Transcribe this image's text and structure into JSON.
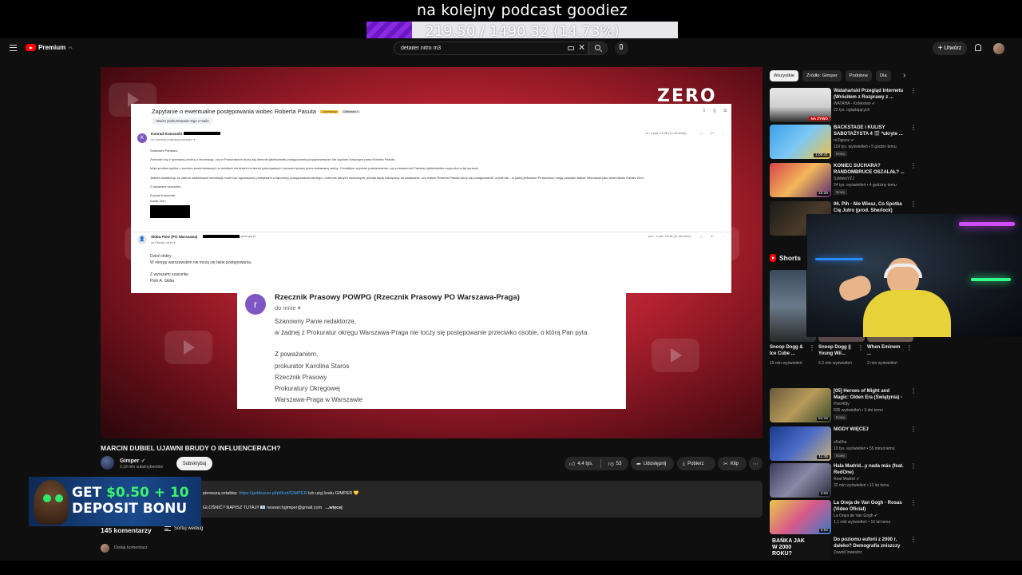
{
  "overlay": {
    "title": "na kolejny podcast goodiez",
    "goal_text": "219.50 / 1490.32 (14.73%)",
    "goal_progress": 0.1473,
    "goal_color": "#8a2be2"
  },
  "topbar": {
    "logo_text": "Premium",
    "logo_suffix": "PL",
    "search_value": "detailer nitro m3",
    "create_label": "Utwórz"
  },
  "player": {
    "zero_logo": "ZERO",
    "email1": {
      "subject": "Zapytanie o ewentualne postępowania wobec Roberta Pasuta",
      "tag1": "Z pomiędzy",
      "tag2": "Odebrane ×",
      "summary_label": "Utwórz podsumowanie tego e-maila",
      "msg1": {
        "initial": "K",
        "sender": "Konrad Kraszuski",
        "to": "do rzecznik.prasowy.prokuratur ▾",
        "date": "śr., 4 paź, 16:38 (12 dni temu)",
        "lines": [
          "Szanowni Państwo,",
          "Zwracam się z uprzejmą prośbą o informację, czy w Prokuraturze toczą się obecnie jakiekolwiek postępowania przygotowawcze lub sądowe dotyczące pana Roberta Pasuta.",
          "Moja prośba wynika z szeroko komentowanych w mediach doniesień na temat potencjalnych naruszeń prawa przez wskazaną osobę. Chciałbym uzyskać potwierdzenie, czy prowadzone Państwo jakiekolwiek czynności w tej sprawie.",
          "Jestem świadomy, że zakres udzielanych informacji może być ograniczony przepisami o tajemnicy postępowania karnego i ochronie danych osobowych, jednak będę wdzięczny za wskazanie, czy wobec Roberta Pasuta toczy się postępowanie, a jeśli tak – w jakiej jednostce Prokuratury mogę uzyskać dalsze informacje jako dziennikarz Kanału Zero.",
          "Z wyrazami szacunku,",
          "Konrad Kraszuski",
          "Kanał Zero"
        ]
      },
      "msg2": {
        "sender": "Skiba Piotr (PO Warszawa)",
        "sender_suffix": "prok.gov.pl",
        "to": "do Pasuta, mnie ▾",
        "date": "pon., 4 paź, 15:48 (11 dni temu)",
        "lines": [
          "Dzień dobry",
          "W okręgu warszawskim nie toczą się takie postępowania.",
          "Z wyrazami szacunku",
          "Piotr A. Skiba"
        ]
      }
    },
    "email2": {
      "initial": "r",
      "sender": "Rzecznik Prasowy POWPG (Rzecznik Prasowy PO Warszawa-Praga)",
      "to": "do mnie ▾",
      "lines": [
        "Szanowny Panie redaktorze,",
        "w żadnej z Prokuratur okręgu Warszawa-Praga nie toczy się postępowanie przeciwko osobie, o którą Pan pyta.",
        "Z poważaniem,",
        "prokurator Karolina Staros",
        "Rzecznik Prasowy",
        "Prokuratury Okręgowej",
        "Warszawa-Praga w Warszawie"
      ]
    }
  },
  "video": {
    "title": "MARCIN DUBIEL UJAWNI BRUDY O INFLUENCERACH?",
    "channel": "Gimper",
    "subscribers": "2,18 mln subskrybentów",
    "subscribe_label": "Subskrybuj",
    "likes": "4,4 tys.",
    "dislikes": "53",
    "share_label": "Udostępnij",
    "download_label": "Pobierz",
    "clip_label": "Klip",
    "desc_line1_prefix": "pierwszą sztabkę:",
    "desc_link": "https://goldsaver.pl/pl/kod/GIMPER",
    "desc_line1_suffix": "lub użyj kodu GIMPER 💛",
    "desc_line2": "GLOŚNIĆ? NAPISZ TUTAJ!! 📧 researchgimper@gmail.com",
    "desc_more": "...więcej",
    "comments_count": "145 komentarzy",
    "sort_label": "Sortuj według",
    "add_comment": "Dodaj komentarz"
  },
  "sidebar": {
    "chips": [
      "Wszystkie",
      "Źródło: Gimper",
      "Podobne",
      "Dla"
    ],
    "recs": [
      {
        "title": "Watahański Przegląd Internetu (Wróciłem z Rozprawy z ...",
        "channel": "WATAHA - Królestwo ✔",
        "meta": "22 tys. oglądających",
        "badge": "",
        "overlay": "NA ŻYWO"
      },
      {
        "title": "BACKSTAGE i KULISY SABOTAŻYSTA 4 🎬 *ukryte ...",
        "channel": "reZigiusz ✔",
        "meta": "119 tys. wyświetleń • 5 godzin temu",
        "badge": "Nowy",
        "overlay": "1:09:41"
      },
      {
        "title": "KONIEC SUCHARA? RANDOMBRUCE OSZALAŁ? ...",
        "channel": "SzkliwoYZJ",
        "meta": "24 tys. wyświetleń • 4 godziny temu",
        "badge": "Nowy",
        "overlay": "22:25"
      },
      {
        "title": "06. Pih - Nie Wiesz, Co Spotka Cię Jutro (prod. Sherlock)",
        "channel": "",
        "meta": "",
        "badge": "",
        "overlay": ""
      }
    ],
    "shorts_label": "Shorts",
    "shorts": [
      {
        "title": "Snoop Dogg & Ice Cube ...",
        "views": "19 mln wyświetleń"
      },
      {
        "title": "Snoop Dogg || Young Wil...",
        "views": "6,3 mln wyświetleń"
      },
      {
        "title": "When Eminem ...",
        "views": "3 mln wyświetleń"
      }
    ],
    "recs2": [
      {
        "title": "[05] Heroes of Might and Magic: Olden Era (Świątynia) - Ciemn...",
        "channel": "Piotr40ty",
        "meta": "835 wyświetleń • 3 dni temu",
        "badge": "Nowy",
        "overlay": "54:16"
      },
      {
        "title": "NIGDY WIĘCEJ",
        "channel": "sf!a0ha",
        "meta": "10 tys. wyświetleń • 55 minut temu",
        "badge": "Nowy",
        "overlay": "11:35"
      },
      {
        "title": "Hala Madrid...y nada más (feat. RedOne)",
        "channel": "Real Madrid ✔",
        "meta": "32 mln wyświetleń • 11 lat temu",
        "badge": "",
        "overlay": "3:06"
      },
      {
        "title": "La Oreja de Van Gogh - Rosas (Video Oficial)",
        "channel": "La Oreja de Van Gogh ✔",
        "meta": "1,1 mld wyświetleń • 16 lat temu",
        "badge": "",
        "overlay": "3:52"
      },
      {
        "title": "Do poziomu euforii z 2000 r. daleko? Demografia zniszczy ...",
        "channel": "Zawód Inwestor",
        "meta": "",
        "badge": "",
        "overlay": ""
      }
    ],
    "rec_thumb_texts": [
      "BAŃKA JAK W 2000 ROKU?"
    ]
  },
  "ad": {
    "line1_a": "GET ",
    "line1_b": "$0.50 + 10",
    "line2": "DEPOSIT BONU"
  }
}
